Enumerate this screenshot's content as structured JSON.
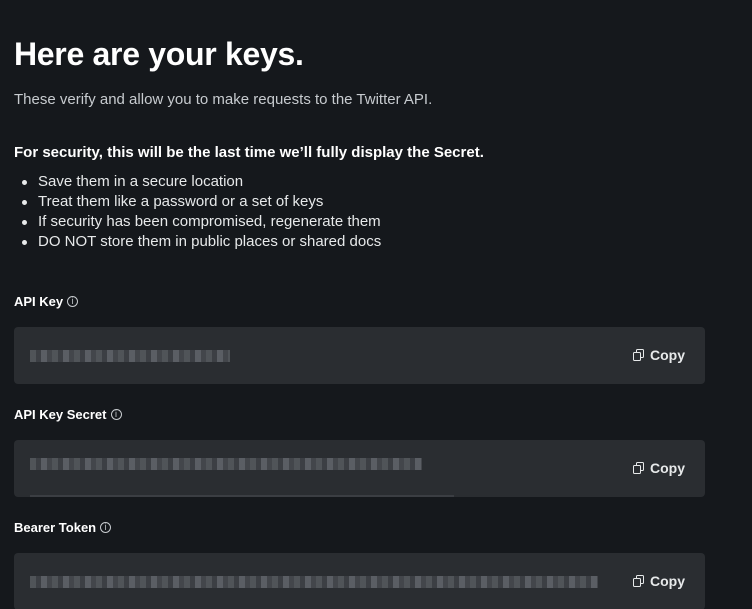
{
  "header": {
    "title": "Here are your keys.",
    "subtitle": "These verify and allow you to make requests to the Twitter API."
  },
  "security": {
    "heading": "For security, this will be the last time we’ll fully display the Secret.",
    "bullets": [
      "Save them in a secure location",
      "Treat them like a password or a set of keys",
      "If security has been compromised, regenerate them",
      "DO NOT store them in public places or shared docs"
    ]
  },
  "keys": [
    {
      "label": "API Key",
      "copy_label": "Copy",
      "info_icon": "info-icon"
    },
    {
      "label": "API Key Secret",
      "copy_label": "Copy",
      "info_icon": "info-icon"
    },
    {
      "label": "Bearer Token",
      "copy_label": "Copy",
      "info_icon": "info-icon"
    }
  ],
  "colors": {
    "background": "#15181c",
    "box": "#2a2d31",
    "text": "#e7e9ea"
  }
}
